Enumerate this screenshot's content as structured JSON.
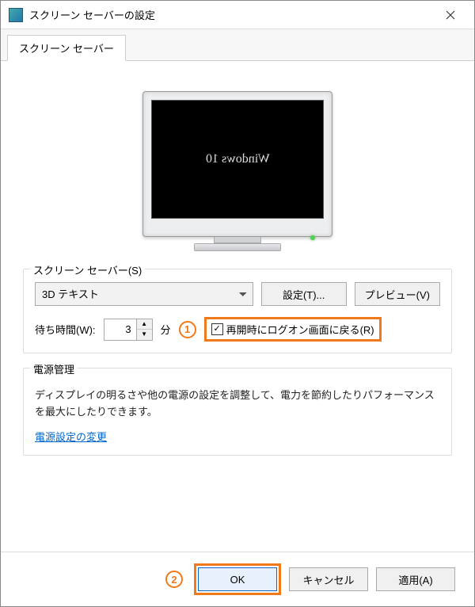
{
  "window": {
    "title": "スクリーン セーバーの設定",
    "tab": "スクリーン セーバー"
  },
  "preview": {
    "screensaver_text": "Windows 10"
  },
  "screensaver": {
    "legend": "スクリーン セーバー(S)",
    "selected": "3D テキスト",
    "settings_btn": "設定(T)...",
    "preview_btn": "プレビュー(V)",
    "wait_label": "待ち時間(W):",
    "wait_value": "3",
    "wait_unit": "分",
    "resume_checkbox_label": "再開時にログオン画面に戻る(R)",
    "resume_checked": true
  },
  "power": {
    "legend": "電源管理",
    "description": "ディスプレイの明るさや他の電源の設定を調整して、電力を節約したりパフォーマンスを最大にしたりできます。",
    "link": "電源設定の変更"
  },
  "buttons": {
    "ok": "OK",
    "cancel": "キャンセル",
    "apply": "適用(A)"
  },
  "annotations": {
    "one": "1",
    "two": "2"
  }
}
